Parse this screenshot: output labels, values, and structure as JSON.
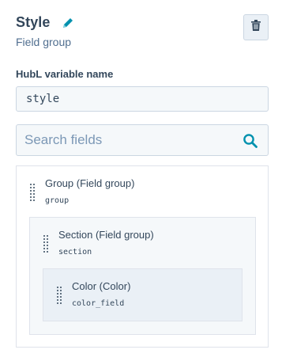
{
  "header": {
    "title": "Style",
    "subtitle": "Field group",
    "edit_icon": "pencil-icon",
    "delete_icon": "trash-icon"
  },
  "variable": {
    "label": "HubL variable name",
    "value": "style"
  },
  "search": {
    "placeholder": "Search fields",
    "icon": "search-icon"
  },
  "tree": {
    "group": {
      "label": "Group (Field group)",
      "name": "group"
    },
    "section": {
      "label": "Section (Field group)",
      "name": "section"
    },
    "color": {
      "label": "Color (Color)",
      "name": "color_field"
    }
  },
  "colors": {
    "text": "#33475b",
    "accent": "#0091ae",
    "border": "#cbd6e2",
    "input_bg": "#f5f8fa",
    "section_bg": "#f5f8fa",
    "color_bg": "#eaf0f6"
  }
}
